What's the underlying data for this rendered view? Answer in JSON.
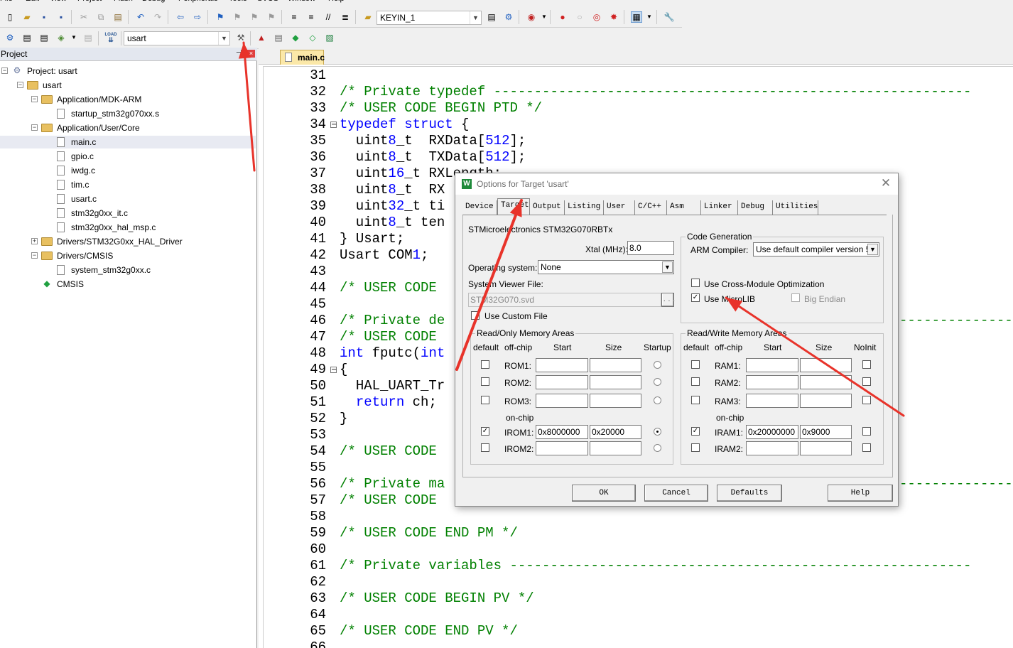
{
  "menu": [
    "File",
    "Edit",
    "View",
    "Project",
    "Flash",
    "Debug",
    "Peripherals",
    "Tools",
    "SVCS",
    "Window",
    "Help"
  ],
  "toolbar1": {
    "target_combo": "KEYIN_1"
  },
  "toolbar2": {
    "target_select": "usart",
    "load_label": "LOAD"
  },
  "project_panel": {
    "title": "Project",
    "pin": "ᵖ",
    "tree": [
      {
        "label": "Project: usart",
        "level": 0,
        "type": "project"
      },
      {
        "label": "usart",
        "level": 1,
        "type": "target"
      },
      {
        "label": "Application/MDK-ARM",
        "level": 2,
        "type": "folder"
      },
      {
        "label": "startup_stm32g070xx.s",
        "level": 3,
        "type": "file"
      },
      {
        "label": "Application/User/Core",
        "level": 2,
        "type": "folder"
      },
      {
        "label": "main.c",
        "level": 3,
        "type": "file",
        "selected": true
      },
      {
        "label": "gpio.c",
        "level": 3,
        "type": "file"
      },
      {
        "label": "iwdg.c",
        "level": 3,
        "type": "file"
      },
      {
        "label": "tim.c",
        "level": 3,
        "type": "file"
      },
      {
        "label": "usart.c",
        "level": 3,
        "type": "file"
      },
      {
        "label": "stm32g0xx_it.c",
        "level": 3,
        "type": "file"
      },
      {
        "label": "stm32g0xx_hal_msp.c",
        "level": 3,
        "type": "file"
      },
      {
        "label": "Drivers/STM32G0xx_HAL_Driver",
        "level": 2,
        "type": "folder"
      },
      {
        "label": "Drivers/CMSIS",
        "level": 2,
        "type": "folder"
      },
      {
        "label": "system_stm32g0xx.c",
        "level": 3,
        "type": "file"
      },
      {
        "label": "CMSIS",
        "level": 2,
        "type": "component"
      }
    ]
  },
  "editor": {
    "tab": "main.c",
    "lines": [
      {
        "n": "31",
        "t": ""
      },
      {
        "n": "32",
        "t": "/* Private typedef -----------------------------------------------------------",
        "c": "cmt"
      },
      {
        "n": "33",
        "t": "/* USER CODE BEGIN PTD */",
        "c": "cmt"
      },
      {
        "n": "34",
        "t": "typedef struct {",
        "fold": true
      },
      {
        "n": "35",
        "t": "  uint8_t  RXData[512];"
      },
      {
        "n": "36",
        "t": "  uint8_t  TXData[512];"
      },
      {
        "n": "37",
        "t": "  uint16_t RXLength;"
      },
      {
        "n": "38",
        "t": "  uint8_t  RX"
      },
      {
        "n": "39",
        "t": "  uint32_t ti"
      },
      {
        "n": "40",
        "t": "  uint8_t ten"
      },
      {
        "n": "41",
        "t": "} Usart;"
      },
      {
        "n": "42",
        "t": "Usart COM1;"
      },
      {
        "n": "43",
        "t": ""
      },
      {
        "n": "44",
        "t": "/* USER CODE ",
        "c": "cmt"
      },
      {
        "n": "45",
        "t": ""
      },
      {
        "n": "46",
        "t": "/* Private de",
        "c": "cmt",
        "tail": "-----------------------------------------------"
      },
      {
        "n": "47",
        "t": "/* USER CODE ",
        "c": "cmt"
      },
      {
        "n": "48",
        "t": "int fputc(int"
      },
      {
        "n": "49",
        "t": "{",
        "fold": true
      },
      {
        "n": "50",
        "t": "  HAL_UART_Tr"
      },
      {
        "n": "51",
        "t": "  return ch;"
      },
      {
        "n": "52",
        "t": "}"
      },
      {
        "n": "53",
        "t": ""
      },
      {
        "n": "54",
        "t": "/* USER CODE ",
        "c": "cmt"
      },
      {
        "n": "55",
        "t": ""
      },
      {
        "n": "56",
        "t": "/* Private ma",
        "c": "cmt",
        "tail": "------------------------------------------------"
      },
      {
        "n": "57",
        "t": "/* USER CODE ",
        "c": "cmt"
      },
      {
        "n": "58",
        "t": ""
      },
      {
        "n": "59",
        "t": "/* USER CODE END PM */",
        "c": "cmt"
      },
      {
        "n": "60",
        "t": ""
      },
      {
        "n": "61",
        "t": "/* Private variables ---------------------------------------------------------",
        "c": "cmt"
      },
      {
        "n": "62",
        "t": ""
      },
      {
        "n": "63",
        "t": "/* USER CODE BEGIN PV */",
        "c": "cmt"
      },
      {
        "n": "64",
        "t": ""
      },
      {
        "n": "65",
        "t": "/* USER CODE END PV */",
        "c": "cmt"
      },
      {
        "n": "66",
        "t": ""
      }
    ]
  },
  "dialog": {
    "title": "Options for Target 'usart'",
    "tabs": [
      "Device",
      "Target",
      "Output",
      "Listing",
      "User",
      "C/C++",
      "Asm",
      "Linker",
      "Debug",
      "Utilities"
    ],
    "active_tab": "Target",
    "device": "STMicroelectronics STM32G070RBTx",
    "xtal_label": "Xtal (MHz):",
    "xtal_value": "8.0",
    "os_label": "Operating system:",
    "os_value": "None",
    "svd_label": "System Viewer File:",
    "svd_value": "STM32G070.svd",
    "svd_browse": "...",
    "custom_file_label": "Use Custom File",
    "codegen": {
      "title": "Code Generation",
      "compiler_label": "ARM Compiler:",
      "compiler_value": "Use default compiler version 5",
      "cross_module": "Use Cross-Module Optimization",
      "microlib": "Use MicroLIB",
      "microlib_checked": true,
      "big_endian": "Big Endian"
    },
    "ro": {
      "title": "Read/Only Memory Areas",
      "headers": [
        "default",
        "off-chip",
        "Start",
        "Size",
        "Startup"
      ],
      "onchip_label": "on-chip",
      "rows": [
        {
          "name": "ROM1:",
          "start": "",
          "size": "",
          "default": false,
          "startup": false
        },
        {
          "name": "ROM2:",
          "start": "",
          "size": "",
          "default": false,
          "startup": false
        },
        {
          "name": "ROM3:",
          "start": "",
          "size": "",
          "default": false,
          "startup": false
        },
        {
          "name": "IROM1:",
          "start": "0x8000000",
          "size": "0x20000",
          "default": true,
          "startup": true
        },
        {
          "name": "IROM2:",
          "start": "",
          "size": "",
          "default": false,
          "startup": false
        }
      ]
    },
    "rw": {
      "title": "Read/Write Memory Areas",
      "headers": [
        "default",
        "off-chip",
        "Start",
        "Size",
        "NoInit"
      ],
      "onchip_label": "on-chip",
      "rows": [
        {
          "name": "RAM1:",
          "start": "",
          "size": "",
          "default": false
        },
        {
          "name": "RAM2:",
          "start": "",
          "size": "",
          "default": false
        },
        {
          "name": "RAM3:",
          "start": "",
          "size": "",
          "default": false
        },
        {
          "name": "IRAM1:",
          "start": "0x20000000",
          "size": "0x9000",
          "default": true
        },
        {
          "name": "IRAM2:",
          "start": "",
          "size": "",
          "default": false
        }
      ]
    },
    "buttons": {
      "ok": "OK",
      "cancel": "Cancel",
      "defaults": "Defaults",
      "help": "Help"
    }
  },
  "colors": {
    "annotation_arrow": "#e8332a",
    "comment": "#008000",
    "keyword": "#0000ff",
    "tab_active": "#fbe8a8"
  }
}
